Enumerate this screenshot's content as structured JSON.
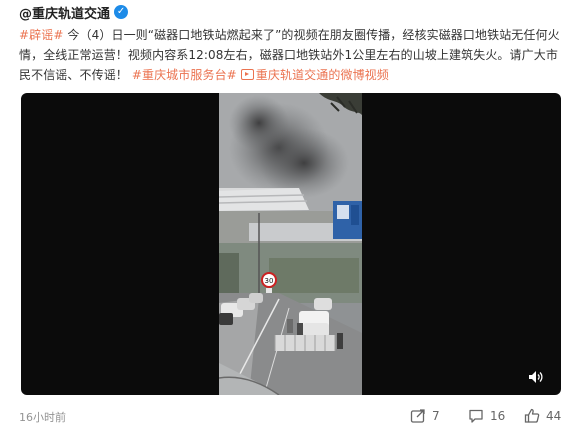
{
  "post": {
    "author": "@重庆轨道交通",
    "verified_badge": "✓",
    "text": {
      "tag": "#辟谣#",
      "body": " 今（4）日一则“磁器口地铁站燃起来了”的视频在朋友圈传播，经核实磁器口地铁站无任何火情，全线正常运营！视频内容系12:08左右，磁器口地铁站外1公里左右的山坡上建筑失火。请广大市民不信谣、不传谣！",
      "topic": "#重庆城市服务台#",
      "video_link": "重庆轨道交通的微博视频"
    },
    "video": {
      "scene_signs": {
        "speed_limit": "30",
        "road_sign": ""
      }
    },
    "footer": {
      "time": "16小时前",
      "share_count": "7",
      "comment_count": "16",
      "like_count": "44"
    }
  },
  "colors": {
    "link": "#eb7350",
    "verified": "#1d8be8",
    "video_bg": "#0b0b0b"
  },
  "icons": [
    "verified-icon",
    "link-play-icon",
    "volume-icon",
    "share-icon",
    "comment-icon",
    "like-icon"
  ]
}
